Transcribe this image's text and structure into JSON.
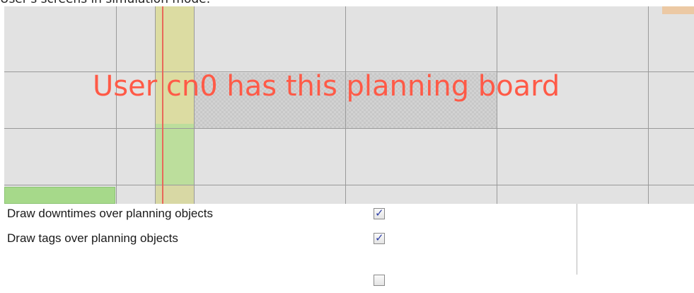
{
  "caption": "User's screens in simulation mode:",
  "board": {
    "watermark": "User cn0 has this planning board"
  },
  "options": [
    {
      "label": "Draw downtimes over planning objects",
      "checked": true
    },
    {
      "label": "Draw tags over planning objects",
      "checked": true
    },
    {
      "label": "",
      "checked": false
    }
  ],
  "check_glyph": "✓",
  "colors": {
    "watermark": "#ff5a47",
    "red_line": "#e8685a",
    "yellow_column": "#dcdca2",
    "green_block": "#a6d98a",
    "board_background": "#e2e2e2"
  }
}
